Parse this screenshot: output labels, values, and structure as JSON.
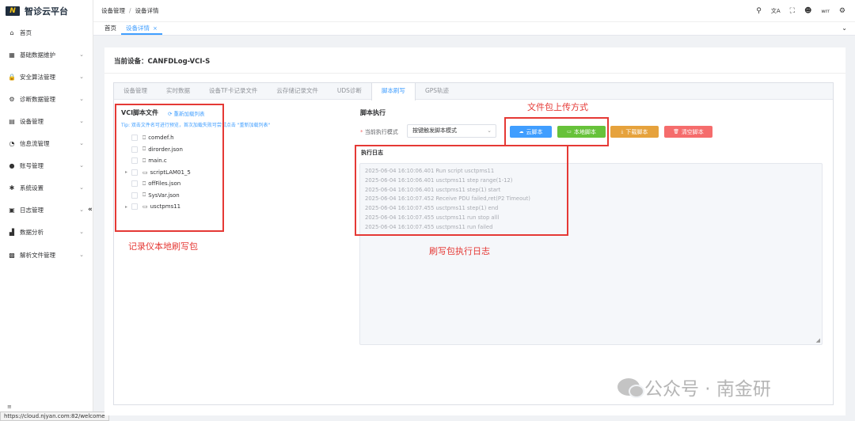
{
  "app": {
    "logo_mark": "N",
    "title": "智诊云平台"
  },
  "sidebar": {
    "items": [
      {
        "label": "首页",
        "icon": "home-icon",
        "glyph": "⌂",
        "has_children": false
      },
      {
        "label": "基础数据维护",
        "icon": "grid-icon",
        "glyph": "▦",
        "has_children": true
      },
      {
        "label": "安全算法管理",
        "icon": "lock-icon",
        "glyph": "🔒",
        "has_children": true
      },
      {
        "label": "诊断数据管理",
        "icon": "gear-icon",
        "glyph": "⚙",
        "has_children": true
      },
      {
        "label": "设备管理",
        "icon": "printer-icon",
        "glyph": "▤",
        "has_children": true
      },
      {
        "label": "信息流管理",
        "icon": "chat-icon",
        "glyph": "◔",
        "has_children": true
      },
      {
        "label": "账号管理",
        "icon": "user-icon",
        "glyph": "●",
        "has_children": true
      },
      {
        "label": "系统设置",
        "icon": "settings-icon",
        "glyph": "✱",
        "has_children": true
      },
      {
        "label": "日志管理",
        "icon": "log-icon",
        "glyph": "▣",
        "has_children": true
      },
      {
        "label": "数据分析",
        "icon": "bar-chart-icon",
        "glyph": "▟",
        "has_children": true
      },
      {
        "label": "解析文件管理",
        "icon": "file-icon",
        "glyph": "▩",
        "has_children": true
      }
    ],
    "collapse_glyph": "«",
    "status_url": "https://cloud.njyan.com:82/welcome"
  },
  "topbar": {
    "breadcrumb": [
      "设备管理",
      "设备详情"
    ],
    "separator": "/",
    "icons": {
      "search": "⚲",
      "translate": "文A",
      "fullscreen": "⛶",
      "avatar": "☻",
      "settings": "⚙"
    },
    "user": "wrr"
  },
  "tagsview": {
    "tags": [
      {
        "label": "首页"
      },
      {
        "label": "设备详情",
        "close": "×"
      }
    ],
    "chevron": "⌄"
  },
  "device": {
    "label": "当前设备：",
    "name": "CANFDLog-VCI-S"
  },
  "tabs": [
    "设备管理",
    "实时数据",
    "设备TF卡记录文件",
    "云存储记录文件",
    "UDS诊断",
    "脚本刷写",
    "GPS轨迹"
  ],
  "active_tab": "脚本刷写",
  "left_panel": {
    "title": "VCI脚本文件",
    "reload": "⟳ 重新加载列表",
    "tip": "Tip: 双击文件名可进行预览，首次加载失败可尝试点击 \"重新加载列表\"",
    "files": [
      {
        "name": "comdef.h",
        "type": "file",
        "expandable": false
      },
      {
        "name": "dirorder.json",
        "type": "file",
        "expandable": false
      },
      {
        "name": "main.c",
        "type": "file",
        "expandable": false
      },
      {
        "name": "scriptLAM01_5",
        "type": "folder",
        "expandable": true
      },
      {
        "name": "offFiles.json",
        "type": "file",
        "expandable": false
      },
      {
        "name": "SysVar.json",
        "type": "file",
        "expandable": false
      },
      {
        "name": "usctpms11",
        "type": "folder",
        "expandable": true
      }
    ]
  },
  "right_panel": {
    "title": "脚本执行",
    "mode_label": "当前执行模式",
    "mode_value": "按键触发脚本模式",
    "buttons": [
      {
        "label": "云脚本",
        "glyph": "☁",
        "color": "#409eff"
      },
      {
        "label": "本地脚本",
        "glyph": "▭",
        "color": "#67c23a"
      },
      {
        "label": "下载脚本",
        "glyph": "⤓",
        "color": "#e6a23c"
      },
      {
        "label": "清空脚本",
        "glyph": "🗑",
        "color": "#f56c6c"
      }
    ],
    "log_title": "执行日志",
    "log_lines": [
      "2025-06-04 16:10:06.401 Run script usctpms11",
      "2025-06-04 16:10:06.401 usctpms11 step range(1-12)",
      "2025-06-04 16:10:06.401 usctpms11 step(1) start",
      "2025-06-04 16:10:07.452 Receive PDU failed,ret(P2 Timeout)",
      "2025-06-04 16:10:07.455 usctpms11 step(1) end",
      "2025-06-04 16:10:07.455 usctpms11 run stop alll",
      "2025-06-04 16:10:07.455 usctpms11 run failed"
    ]
  },
  "annotations": {
    "upload_methods": "文件包上传方式",
    "local_package": "记录仪本地刷写包",
    "exec_log": "刷写包执行日志",
    "color": "#e53935"
  },
  "watermark": {
    "text": "公众号 · 南金研"
  }
}
